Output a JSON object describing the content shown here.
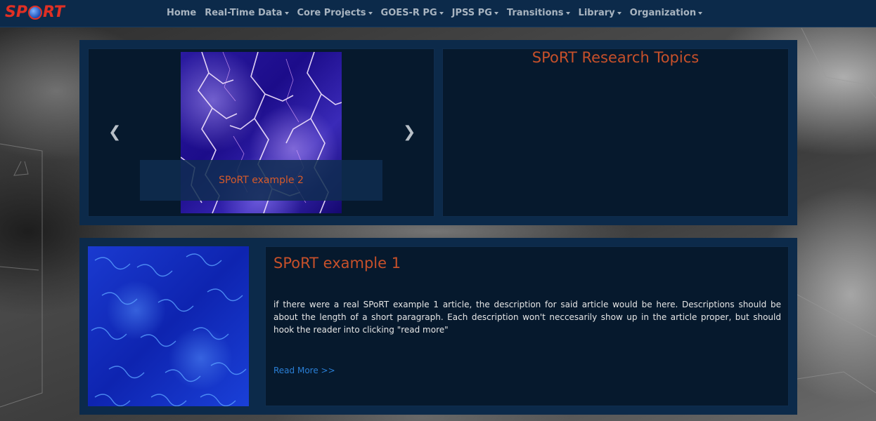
{
  "brand": {
    "logo_text_left": "SP",
    "logo_text_right": "RT"
  },
  "nav": {
    "items": [
      {
        "label": "Home",
        "dropdown": false
      },
      {
        "label": "Real-Time Data",
        "dropdown": true
      },
      {
        "label": "Core Projects",
        "dropdown": true
      },
      {
        "label": "GOES-R PG",
        "dropdown": true
      },
      {
        "label": "JPSS PG",
        "dropdown": true
      },
      {
        "label": "Transitions",
        "dropdown": true
      },
      {
        "label": "Library",
        "dropdown": true
      },
      {
        "label": "Organization",
        "dropdown": true
      }
    ]
  },
  "carousel": {
    "caption": "SPoRT example 2",
    "prev_icon": "chevron-left-icon",
    "next_icon": "chevron-right-icon"
  },
  "topics": {
    "title": "SPoRT Research Topics"
  },
  "article": {
    "title": "SPoRT example 1",
    "description": "if there were a real SPoRT example 1 article, the description for said article would be here. Descriptions should be about the length of a short paragraph. Each description won't neccesarily show up in the article proper, but should hook the reader into clicking \"read more\"",
    "read_more": "Read More >>"
  },
  "colors": {
    "navbar": "#0c2a4a",
    "panel": "#0c2a4a",
    "inner": "#06192d",
    "accent_title": "#c6502a",
    "link": "#2a7fd6",
    "logo": "#e03024"
  }
}
